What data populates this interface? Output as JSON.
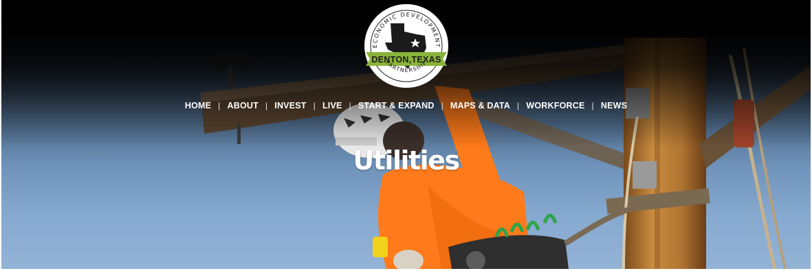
{
  "logo": {
    "top_text": "ECONOMIC DEVELOPMENT",
    "banner_text": "DENTON,TEXAS",
    "bottom_text": "PARTNERSHIP",
    "accent_color": "#8ab33a",
    "icon": "texas-star-icon"
  },
  "nav": {
    "items": [
      "HOME",
      "ABOUT",
      "INVEST",
      "LIVE",
      "START & EXPAND",
      "MAPS & DATA",
      "WORKFORCE",
      "NEWS"
    ],
    "separator": "|"
  },
  "page": {
    "title": "Utilities"
  },
  "hero": {
    "image": "lineman-on-utility-pole",
    "sky_color": "#86a9cf",
    "shirt_color": "#ff7a1a"
  }
}
